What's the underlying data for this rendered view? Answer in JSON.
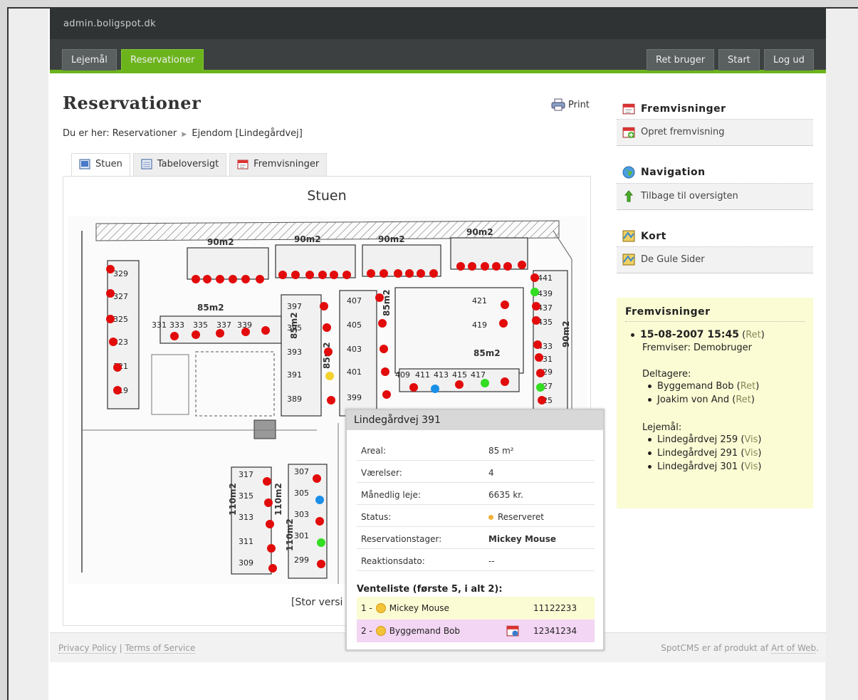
{
  "header": {
    "site_title": "admin.boligspot.dk"
  },
  "nav": {
    "tabs": [
      {
        "label": "Lejemål"
      },
      {
        "label": "Reservationer"
      }
    ],
    "right": [
      {
        "label": "Ret bruger"
      },
      {
        "label": "Start"
      },
      {
        "label": "Log ud"
      }
    ]
  },
  "page": {
    "title": "Reservationer",
    "print_label": "Print",
    "breadcrumb": {
      "prefix": "Du er her:",
      "items": [
        "Reservationer",
        "Ejendom [Lindegårdvej]"
      ]
    },
    "tabs": [
      {
        "label": "Stuen"
      },
      {
        "label": "Tabeloversigt"
      },
      {
        "label": "Fremvisninger"
      }
    ],
    "panel_title": "Stuen",
    "large_version": "[Stor versi"
  },
  "floorplan": {
    "units": [
      [
        "329",
        64,
        84
      ],
      [
        "327",
        64,
        116
      ],
      [
        "325",
        64,
        148
      ],
      [
        "323",
        64,
        180
      ],
      [
        "321",
        64,
        214
      ],
      [
        "319",
        64,
        248
      ],
      [
        "331",
        118,
        156
      ],
      [
        "333",
        143,
        156
      ],
      [
        "335",
        176,
        156
      ],
      [
        "337",
        209,
        156
      ],
      [
        "339",
        238,
        156
      ],
      [
        "397",
        308,
        130
      ],
      [
        "395",
        308,
        160
      ],
      [
        "393",
        308,
        194
      ],
      [
        "391",
        308,
        226
      ],
      [
        "389",
        308,
        260
      ],
      [
        "407",
        392,
        122
      ],
      [
        "405",
        392,
        156
      ],
      [
        "403",
        392,
        190
      ],
      [
        "401",
        392,
        222
      ],
      [
        "399",
        392,
        258
      ],
      [
        "421",
        568,
        122
      ],
      [
        "419",
        568,
        156
      ],
      [
        "409",
        460,
        226
      ],
      [
        "411",
        488,
        226
      ],
      [
        "413",
        514,
        226
      ],
      [
        "415",
        540,
        226
      ],
      [
        "417",
        566,
        226
      ],
      [
        "441",
        660,
        90
      ],
      [
        "439",
        660,
        112
      ],
      [
        "437",
        660,
        132
      ],
      [
        "435",
        660,
        152
      ],
      [
        "433",
        660,
        186
      ],
      [
        "431",
        660,
        204
      ],
      [
        "427",
        660,
        242
      ],
      [
        "429",
        660,
        222
      ],
      [
        "425",
        660,
        262
      ],
      [
        "317",
        240,
        366
      ],
      [
        "315",
        240,
        396
      ],
      [
        "313",
        240,
        426
      ],
      [
        "311",
        240,
        460
      ],
      [
        "309",
        240,
        490
      ],
      [
        "307",
        318,
        362
      ],
      [
        "305",
        318,
        392
      ],
      [
        "303",
        318,
        422
      ],
      [
        "301",
        318,
        452
      ],
      [
        "299",
        318,
        486
      ]
    ],
    "area_labels": [
      "90m2",
      "90m2",
      "90m2",
      "90m2",
      "85m2",
      "85m2",
      "85m2",
      "85m2",
      "85m2",
      "90m2",
      "110m2",
      "110m2",
      "110m2"
    ],
    "dots": [
      [
        60,
        74,
        "red"
      ],
      [
        60,
        108,
        "red"
      ],
      [
        60,
        144,
        "red"
      ],
      [
        64,
        176,
        "red"
      ],
      [
        70,
        212,
        "red"
      ],
      [
        70,
        244,
        "red"
      ],
      [
        180,
        88,
        "red"
      ],
      [
        196,
        88,
        "red"
      ],
      [
        214,
        88,
        "red"
      ],
      [
        232,
        88,
        "red"
      ],
      [
        250,
        88,
        "red"
      ],
      [
        270,
        88,
        "red"
      ],
      [
        302,
        82,
        "red"
      ],
      [
        320,
        82,
        "red"
      ],
      [
        340,
        82,
        "red"
      ],
      [
        358,
        82,
        "red"
      ],
      [
        374,
        82,
        "red"
      ],
      [
        392,
        82,
        "red"
      ],
      [
        426,
        80,
        "red"
      ],
      [
        444,
        80,
        "red"
      ],
      [
        464,
        80,
        "red"
      ],
      [
        480,
        80,
        "red"
      ],
      [
        496,
        80,
        "red"
      ],
      [
        514,
        80,
        "red"
      ],
      [
        552,
        70,
        "red"
      ],
      [
        568,
        70,
        "red"
      ],
      [
        586,
        70,
        "red"
      ],
      [
        602,
        70,
        "red"
      ],
      [
        618,
        70,
        "red"
      ],
      [
        638,
        68,
        "red"
      ],
      [
        150,
        168,
        "red"
      ],
      [
        180,
        166,
        "red"
      ],
      [
        214,
        164,
        "red"
      ],
      [
        250,
        162,
        "red"
      ],
      [
        278,
        160,
        "red"
      ],
      [
        360,
        126,
        "red"
      ],
      [
        364,
        156,
        "red"
      ],
      [
        366,
        190,
        "red"
      ],
      [
        368,
        224,
        "yellow"
      ],
      [
        370,
        258,
        "red"
      ],
      [
        438,
        114,
        "red"
      ],
      [
        442,
        150,
        "red"
      ],
      [
        444,
        186,
        "red"
      ],
      [
        446,
        218,
        "red"
      ],
      [
        448,
        250,
        "red"
      ],
      [
        614,
        124,
        "red"
      ],
      [
        612,
        150,
        "red"
      ],
      [
        486,
        240,
        "red"
      ],
      [
        516,
        242,
        "blue"
      ],
      [
        550,
        236,
        "red"
      ],
      [
        586,
        234,
        "green"
      ],
      [
        614,
        232,
        "red"
      ],
      [
        656,
        86,
        "red"
      ],
      [
        656,
        106,
        "green"
      ],
      [
        658,
        126,
        "red"
      ],
      [
        658,
        146,
        "red"
      ],
      [
        660,
        180,
        "red"
      ],
      [
        662,
        198,
        "red"
      ],
      [
        664,
        220,
        "red"
      ],
      [
        664,
        240,
        "green"
      ],
      [
        666,
        258,
        "red"
      ],
      [
        280,
        372,
        "red"
      ],
      [
        282,
        402,
        "red"
      ],
      [
        284,
        432,
        "red"
      ],
      [
        286,
        466,
        "red"
      ],
      [
        288,
        494,
        "red"
      ],
      [
        350,
        368,
        "red"
      ],
      [
        354,
        398,
        "blue"
      ],
      [
        354,
        428,
        "red"
      ],
      [
        356,
        458,
        "green"
      ],
      [
        356,
        488,
        "red"
      ]
    ]
  },
  "colors": {
    "red": "#e20b0b",
    "green": "#33dd22",
    "blue": "#1a8fe8",
    "yellow": "#f2d22e",
    "accent": "#6cb41c"
  },
  "sidebar": {
    "fremvisninger_title": "Fremvisninger",
    "fremvisninger_link": "Opret fremvisning",
    "navigation_title": "Navigation",
    "navigation_link": "Tilbage til oversigten",
    "kort_title": "Kort",
    "kort_link": "De Gule Sider"
  },
  "showings": {
    "title": "Fremvisninger",
    "datetime": "15-08-2007 15:45",
    "ret": "Ret",
    "open_paren": "(",
    "close_paren": ")",
    "fremviser": "Fremviser: Demobruger",
    "deltagere_label": "Deltagere:",
    "deltagere": [
      {
        "name": "Byggemand Bob",
        "link": "Ret"
      },
      {
        "name": "Joakim von And",
        "link": "Ret"
      }
    ],
    "lejemaal_label": "Lejemål:",
    "lejemaal": [
      {
        "name": "Lindegårdvej 259",
        "link": "Vis"
      },
      {
        "name": "Lindegårdvej 291",
        "link": "Vis"
      },
      {
        "name": "Lindegårdvej 301",
        "link": "Vis"
      }
    ]
  },
  "popup": {
    "title": "Lindegårdvej 391",
    "rows": [
      {
        "key": "Areal:",
        "value": "85 m²"
      },
      {
        "key": "Værelser:",
        "value": "4"
      },
      {
        "key": "Månedlig leje:",
        "value": "6635 kr."
      },
      {
        "key": "Status:",
        "value": "Reserveret"
      },
      {
        "key": "Reservationstager:",
        "value": "Mickey Mouse"
      },
      {
        "key": "Reaktionsdato:",
        "value": "--"
      }
    ],
    "waitlist_title": "Venteliste (første 5, i alt 2):",
    "waitlist": [
      {
        "rank": "1 -",
        "name": "Mickey Mouse",
        "number": "11122233"
      },
      {
        "rank": "2 -",
        "name": "Byggemand Bob",
        "number": "12341234"
      }
    ]
  },
  "footer": {
    "privacy": "Privacy Policy",
    "separator": "|",
    "terms": "Terms of Service",
    "credit_prefix": "SpotCMS er af produkt af",
    "credit_link": "Art of Web",
    "credit_suffix": "."
  }
}
